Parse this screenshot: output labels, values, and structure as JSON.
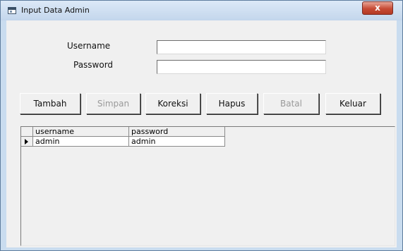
{
  "window": {
    "title": "Input Data Admin",
    "close_label": "x"
  },
  "form": {
    "username_label": "Username",
    "username_value": "",
    "password_label": "Password",
    "password_value": ""
  },
  "buttons": {
    "tambah": "Tambah",
    "simpan": "Simpan",
    "koreksi": "Koreksi",
    "hapus": "Hapus",
    "batal": "Batal",
    "keluar": "Keluar"
  },
  "grid": {
    "columns": [
      "username",
      "password"
    ],
    "rows": [
      [
        "admin",
        "admin"
      ]
    ],
    "current_row_indicator": "arrow-right-icon"
  },
  "colors": {
    "titlebar": "#c3d6ec",
    "client_background": "#f0f0f0",
    "close_button": "#c74b35",
    "disabled_text": "#9a9a9a"
  }
}
